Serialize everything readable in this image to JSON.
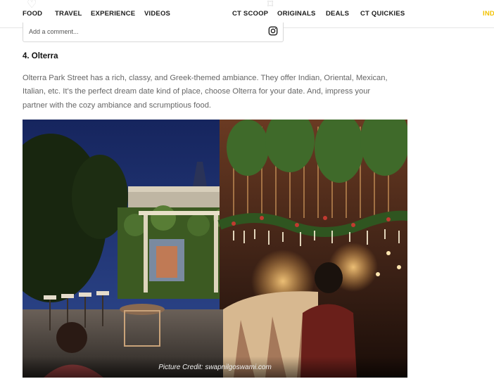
{
  "nav": {
    "items": [
      "FOOD",
      "TRAVEL",
      "EXPERIENCE",
      "VIDEOS",
      "CT SCOOP",
      "ORIGINALS",
      "DEALS",
      "CT QUICKIES"
    ],
    "region_label": "IND",
    "region_color": "#f2c200"
  },
  "comment": {
    "placeholder": "Add a comment...",
    "icon": "instagram-icon"
  },
  "article": {
    "heading": "4. Olterra",
    "paragraph": "Olterra Park Street has a rich, classy, and Greek-themed ambiance. They offer Indian, Oriental, Mexican, Italian, etc. It’s the perfect dream date kind of place, choose Olterra for your date. And, impress your partner with the cozy ambiance and scrumptious food.",
    "image_credit": "Picture Credit: swapnilgoswami.com"
  }
}
